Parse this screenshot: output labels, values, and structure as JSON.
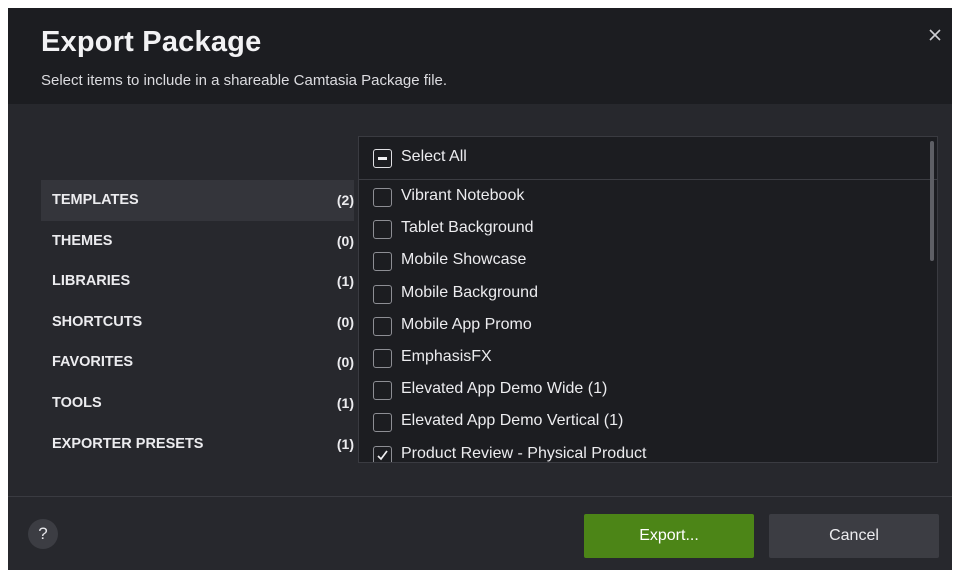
{
  "dialog": {
    "title": "Export Package",
    "subtitle": "Select items to include in a shareable Camtasia Package file."
  },
  "categories": [
    {
      "label": "TEMPLATES",
      "count": "(2)",
      "selected": true
    },
    {
      "label": "THEMES",
      "count": "(0)",
      "selected": false
    },
    {
      "label": "LIBRARIES",
      "count": "(1)",
      "selected": false
    },
    {
      "label": "SHORTCUTS",
      "count": "(0)",
      "selected": false
    },
    {
      "label": "FAVORITES",
      "count": "(0)",
      "selected": false
    },
    {
      "label": "TOOLS",
      "count": "(1)",
      "selected": false
    },
    {
      "label": "EXPORTER PRESETS",
      "count": "(1)",
      "selected": false
    }
  ],
  "items_panel": {
    "select_all_label": "Select All",
    "select_all_state": "indeterminate",
    "items": [
      {
        "label": "Vibrant Notebook",
        "checked": false
      },
      {
        "label": "Tablet Background",
        "checked": false
      },
      {
        "label": "Mobile Showcase",
        "checked": false
      },
      {
        "label": "Mobile Background",
        "checked": false
      },
      {
        "label": "Mobile App Promo",
        "checked": false
      },
      {
        "label": "EmphasisFX",
        "checked": false
      },
      {
        "label": "Elevated App Demo Wide (1)",
        "checked": false
      },
      {
        "label": "Elevated App Demo Vertical (1)",
        "checked": false
      },
      {
        "label": "Product Review - Physical Product",
        "checked": true
      }
    ]
  },
  "footer": {
    "help_label": "?",
    "export_label": "Export...",
    "cancel_label": "Cancel"
  },
  "colors": {
    "accent_export": "#4c8517",
    "dialog_bg": "#27282d",
    "header_bg": "#1c1d21"
  },
  "icons": {
    "close": "close-icon",
    "help": "help-icon",
    "checkmark": "checkmark-icon"
  }
}
